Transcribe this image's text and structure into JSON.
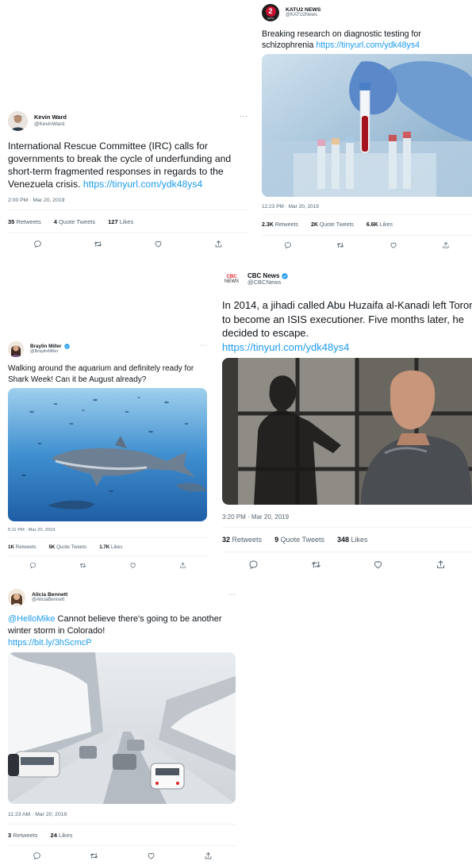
{
  "tweets": {
    "kevin": {
      "name": "Kevin Ward",
      "handle": "@KevinWard",
      "text": "International Rescue Committee (IRC) calls for governments to break the cycle of underfunding and short-term fragmented responses in regards to the Venezuela crisis. ",
      "link": "https://tinyurl.com/ydk48ys4",
      "timestamp": "2:00 PM · Mar 20, 2019",
      "retweets": "35",
      "retweets_label": "Retweets",
      "quotes": "4",
      "quotes_label": "Quote Tweets",
      "likes": "127",
      "likes_label": "Likes"
    },
    "katu": {
      "name": "KATU2 NEWS",
      "handle": "@KATU2News",
      "avatar_text": "2",
      "avatar_sub": "KATU",
      "text": "Breaking research on diagnostic testing for schizophrenia  ",
      "link": "https://tinyurl.com/ydk48ys4",
      "timestamp": "12:23 PM · Mar 20, 2019",
      "retweets": "2.3K",
      "retweets_label": "Retweets",
      "quotes": "2K",
      "quotes_label": "Quote Tweets",
      "likes": "6.6K",
      "likes_label": "Likes"
    },
    "cbc": {
      "name": "CBC News",
      "handle": "@CBCNews",
      "avatar_text": "CBC",
      "avatar_sub": "NEWS",
      "text": "In 2014, a jihadi called Abu Huzaifa al-Kanadi left Toronto to become an ISIS executioner. Five months later, he decided to escape.",
      "link": "https://tinyurl.com/ydk48ys4",
      "timestamp": "3:20 PM · Mar 20, 2019",
      "retweets": "32",
      "retweets_label": "Retweets",
      "quotes": "9",
      "quotes_label": "Quote Tweets",
      "likes": "348",
      "likes_label": "Likes"
    },
    "braylin": {
      "name": "Braylin Miller",
      "handle": "@BraylinMiller",
      "text": "Walking around the aquarium and definitely ready for Shark Week! Can it be August already?",
      "timestamp": "5:11 PM · Mar 20, 2019",
      "retweets": "1K",
      "retweets_label": "Retweets",
      "quotes": "5K",
      "quotes_label": "Quote Tweets",
      "likes": "1.7K",
      "likes_label": "Likes"
    },
    "alicia": {
      "name": "Alicia Bennett",
      "handle": "@AliciaBennett",
      "mention": "@HelloMike",
      "text": " Cannot believe there's going to be another winter storm in Colorado!",
      "link": "https://bit.ly/3hScmcP",
      "timestamp": "11:23 AM · Mar 20, 2019",
      "retweets": "3",
      "retweets_label": "Retweets",
      "likes": "24",
      "likes_label": "Likes"
    }
  },
  "more_label": "···",
  "colors": {
    "link": "#1d9bf0",
    "verified": "#1d9bf0",
    "secondary": "#536471",
    "katu_red": "#c8102e",
    "cbc_red": "#e0242b"
  },
  "icons": [
    "reply-icon",
    "retweet-icon",
    "like-icon",
    "share-icon",
    "verified-icon",
    "more-icon"
  ]
}
